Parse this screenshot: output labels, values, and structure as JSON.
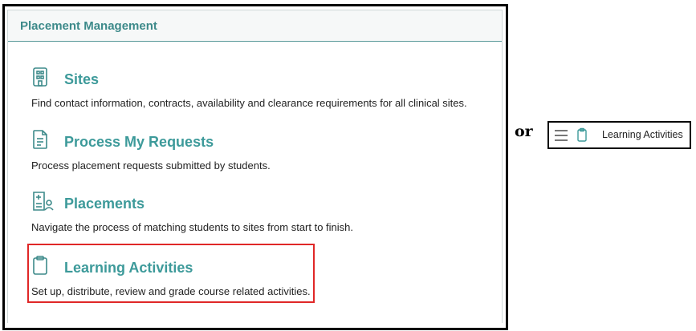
{
  "card": {
    "title": "Placement Management"
  },
  "items": [
    {
      "icon": "building-icon",
      "title": "Sites",
      "description": "Find contact information, contracts, availability and clearance requirements for all clinical sites."
    },
    {
      "icon": "document-icon",
      "title": "Process My Requests",
      "description": "Process placement requests submitted by students."
    },
    {
      "icon": "placement-person-icon",
      "title": "Placements",
      "description": "Navigate the process of matching students to sites from start to finish."
    },
    {
      "icon": "clipboard-icon",
      "title": "Learning Activities",
      "description": "Set up, distribute, review and grade course related activities."
    }
  ],
  "separator": "or",
  "alt_nav": {
    "menu_icon": "hamburger-menu-icon",
    "icon": "clipboard-icon",
    "label": "Learning Activities"
  },
  "colors": {
    "accent": "#3d9a9a",
    "highlight": "#e02727"
  }
}
